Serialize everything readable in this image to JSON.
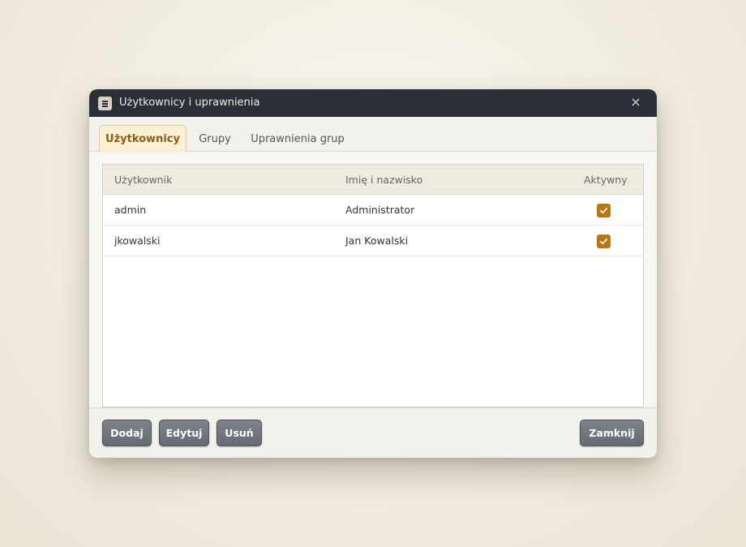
{
  "window": {
    "title": "Użytkownicy i uprawnienia",
    "icon": "menu-icon",
    "close_icon": "close-icon",
    "close_glyph": "×"
  },
  "tabs": [
    {
      "label": "Użytkownicy",
      "active": true
    },
    {
      "label": "Grupy",
      "active": false
    },
    {
      "label": "Uprawnienia grup",
      "active": false
    }
  ],
  "table": {
    "columns": [
      "Użytkownik",
      "Imię i nazwisko",
      "Aktywny"
    ],
    "rows": [
      {
        "username": "admin",
        "full_name": "Administrator",
        "active": true
      },
      {
        "username": "jkowalski",
        "full_name": "Jan Kowalski",
        "active": true
      }
    ]
  },
  "buttons": {
    "add": "Dodaj",
    "edit": "Edytuj",
    "delete": "Usuń",
    "close": "Zamknij"
  },
  "colors": {
    "accent": "#b7790f",
    "titlebar": "#2b2f38",
    "active_tab_bg": "#fbf0d6",
    "button": "#72777f"
  }
}
